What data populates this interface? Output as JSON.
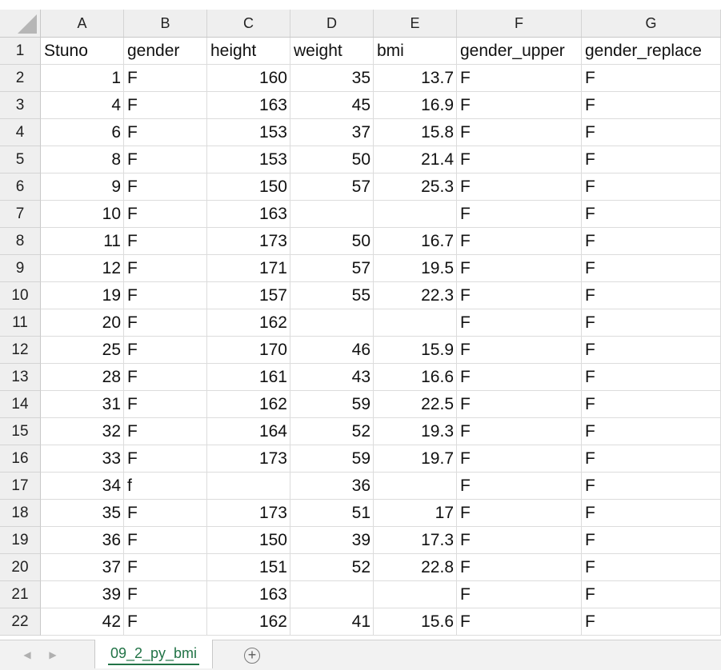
{
  "columns": [
    "A",
    "B",
    "C",
    "D",
    "E",
    "F",
    "G"
  ],
  "header_row": {
    "num": "1",
    "cells": [
      "Stuno",
      "gender",
      "height",
      "weight",
      "bmi",
      "gender_upper",
      "gender_replace"
    ]
  },
  "rows": [
    {
      "num": "2",
      "stuno": "1",
      "gender": "F",
      "height": "160",
      "weight": "35",
      "bmi": "13.7",
      "gender_upper": "F",
      "gender_replace": "F"
    },
    {
      "num": "3",
      "stuno": "4",
      "gender": "F",
      "height": "163",
      "weight": "45",
      "bmi": "16.9",
      "gender_upper": "F",
      "gender_replace": "F"
    },
    {
      "num": "4",
      "stuno": "6",
      "gender": "F",
      "height": "153",
      "weight": "37",
      "bmi": "15.8",
      "gender_upper": "F",
      "gender_replace": "F"
    },
    {
      "num": "5",
      "stuno": "8",
      "gender": "F",
      "height": "153",
      "weight": "50",
      "bmi": "21.4",
      "gender_upper": "F",
      "gender_replace": "F"
    },
    {
      "num": "6",
      "stuno": "9",
      "gender": "F",
      "height": "150",
      "weight": "57",
      "bmi": "25.3",
      "gender_upper": "F",
      "gender_replace": "F"
    },
    {
      "num": "7",
      "stuno": "10",
      "gender": "F",
      "height": "163",
      "weight": "",
      "bmi": "",
      "gender_upper": "F",
      "gender_replace": "F"
    },
    {
      "num": "8",
      "stuno": "11",
      "gender": "F",
      "height": "173",
      "weight": "50",
      "bmi": "16.7",
      "gender_upper": "F",
      "gender_replace": "F"
    },
    {
      "num": "9",
      "stuno": "12",
      "gender": "F",
      "height": "171",
      "weight": "57",
      "bmi": "19.5",
      "gender_upper": "F",
      "gender_replace": "F"
    },
    {
      "num": "10",
      "stuno": "19",
      "gender": "F",
      "height": "157",
      "weight": "55",
      "bmi": "22.3",
      "gender_upper": "F",
      "gender_replace": "F"
    },
    {
      "num": "11",
      "stuno": "20",
      "gender": "F",
      "height": "162",
      "weight": "",
      "bmi": "",
      "gender_upper": "F",
      "gender_replace": "F"
    },
    {
      "num": "12",
      "stuno": "25",
      "gender": "F",
      "height": "170",
      "weight": "46",
      "bmi": "15.9",
      "gender_upper": "F",
      "gender_replace": "F"
    },
    {
      "num": "13",
      "stuno": "28",
      "gender": "F",
      "height": "161",
      "weight": "43",
      "bmi": "16.6",
      "gender_upper": "F",
      "gender_replace": "F"
    },
    {
      "num": "14",
      "stuno": "31",
      "gender": "F",
      "height": "162",
      "weight": "59",
      "bmi": "22.5",
      "gender_upper": "F",
      "gender_replace": "F"
    },
    {
      "num": "15",
      "stuno": "32",
      "gender": "F",
      "height": "164",
      "weight": "52",
      "bmi": "19.3",
      "gender_upper": "F",
      "gender_replace": "F"
    },
    {
      "num": "16",
      "stuno": "33",
      "gender": "F",
      "height": "173",
      "weight": "59",
      "bmi": "19.7",
      "gender_upper": "F",
      "gender_replace": "F"
    },
    {
      "num": "17",
      "stuno": "34",
      "gender": "f",
      "height": "",
      "weight": "36",
      "bmi": "",
      "gender_upper": "F",
      "gender_replace": "F"
    },
    {
      "num": "18",
      "stuno": "35",
      "gender": "F",
      "height": "173",
      "weight": "51",
      "bmi": "17",
      "gender_upper": "F",
      "gender_replace": "F"
    },
    {
      "num": "19",
      "stuno": "36",
      "gender": "F",
      "height": "150",
      "weight": "39",
      "bmi": "17.3",
      "gender_upper": "F",
      "gender_replace": "F"
    },
    {
      "num": "20",
      "stuno": "37",
      "gender": "F",
      "height": "151",
      "weight": "52",
      "bmi": "22.8",
      "gender_upper": "F",
      "gender_replace": "F"
    },
    {
      "num": "21",
      "stuno": "39",
      "gender": "F",
      "height": "163",
      "weight": "",
      "bmi": "",
      "gender_upper": "F",
      "gender_replace": "F"
    },
    {
      "num": "22",
      "stuno": "42",
      "gender": "F",
      "height": "162",
      "weight": "41",
      "bmi": "15.6",
      "gender_upper": "F",
      "gender_replace": "F"
    }
  ],
  "sheet_tab": {
    "label": "09_2_py_bmi"
  },
  "tab_bar": {
    "prev_icon": "left-arrow-icon",
    "next_icon": "right-arrow-icon",
    "add_icon": "plus-circle-icon"
  },
  "colors": {
    "accent": "#217346",
    "header_bg": "#efefef",
    "grid": "#dcdcdc"
  }
}
